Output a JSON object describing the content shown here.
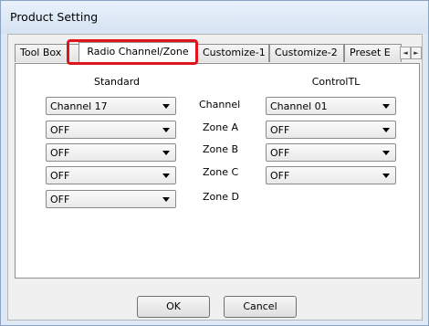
{
  "window": {
    "title": "Product Setting"
  },
  "tabs": [
    {
      "label": "Tool Box"
    },
    {
      "label": "Radio Channel/Zone"
    },
    {
      "label": "Customize-1"
    },
    {
      "label": "Customize-2"
    },
    {
      "label": "Preset E"
    }
  ],
  "tab_scroll": {
    "left": "◄",
    "right": "►"
  },
  "columns": {
    "standard": "Standard",
    "controltl": "ControlTL"
  },
  "rows": [
    {
      "label": "Channel",
      "standard": "Channel 17",
      "controltl": "Channel 01"
    },
    {
      "label": "Zone A",
      "standard": "OFF",
      "controltl": "OFF"
    },
    {
      "label": "Zone B",
      "standard": "OFF",
      "controltl": "OFF"
    },
    {
      "label": "Zone C",
      "standard": "OFF",
      "controltl": "OFF"
    },
    {
      "label": "Zone D",
      "standard": "OFF"
    }
  ],
  "buttons": {
    "ok": "OK",
    "cancel": "Cancel"
  },
  "colors": {
    "highlight": "#e0141b",
    "window": "#dfe9f5",
    "panel": "#ffffff"
  }
}
